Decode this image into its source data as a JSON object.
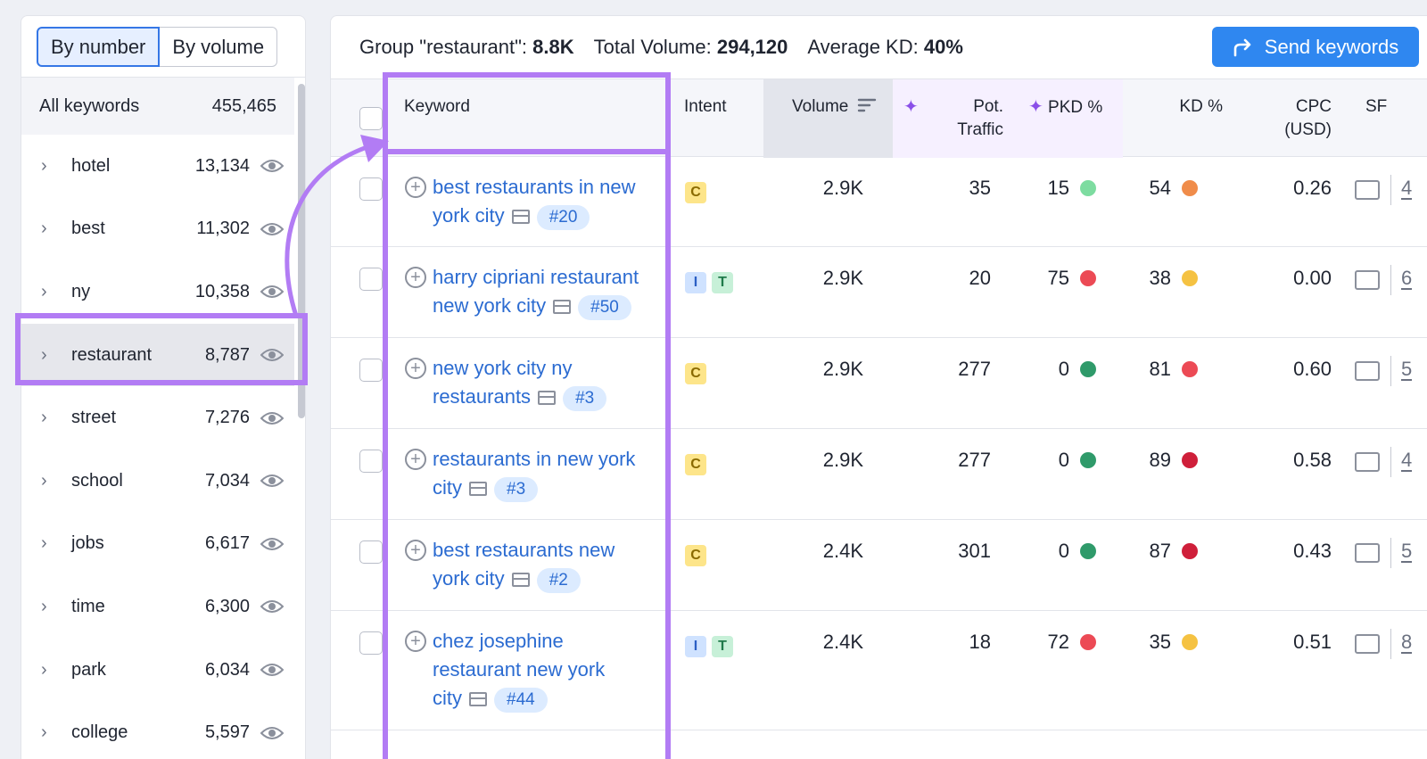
{
  "sidebar": {
    "toggle": {
      "by_number": "By number",
      "by_volume": "By volume"
    },
    "all_keywords": {
      "label": "All keywords",
      "count": "455,465"
    },
    "items": [
      {
        "name": "hotel",
        "count": "13,134"
      },
      {
        "name": "best",
        "count": "11,302"
      },
      {
        "name": "ny",
        "count": "10,358"
      },
      {
        "name": "restaurant",
        "count": "8,787"
      },
      {
        "name": "street",
        "count": "7,276"
      },
      {
        "name": "school",
        "count": "7,034"
      },
      {
        "name": "jobs",
        "count": "6,617"
      },
      {
        "name": "time",
        "count": "6,300"
      },
      {
        "name": "park",
        "count": "6,034"
      },
      {
        "name": "college",
        "count": "5,597"
      }
    ],
    "selected": "restaurant"
  },
  "header": {
    "group_label": "Group \"restaurant\":",
    "group_value": "8.8K",
    "volume_label": "Total Volume:",
    "volume_value": "294,120",
    "kd_label": "Average KD:",
    "kd_value": "40%",
    "send_button": "Send keywords"
  },
  "table": {
    "columns": {
      "keyword": "Keyword",
      "intent": "Intent",
      "volume": "Volume",
      "pot_traffic_1": "Pot.",
      "pot_traffic_2": "Traffic",
      "pkd": "PKD %",
      "kd": "KD %",
      "cpc_1": "CPC",
      "cpc_2": "(USD)",
      "sf": "SF"
    },
    "rows": [
      {
        "kw1": "best restaurants in new",
        "kw2": "york city",
        "kw3": "",
        "rank": "#20",
        "intents": [
          "C"
        ],
        "volume": "2.9K",
        "pot": "35",
        "pkd": "15",
        "pkd_color": "#7ddca0",
        "kd": "54",
        "kd_color": "#f08c4a",
        "cpc": "0.26",
        "sf": "4"
      },
      {
        "kw1": "harry cipriani restaurant",
        "kw2": "new york city",
        "kw3": "",
        "rank": "#50",
        "intents": [
          "I",
          "T"
        ],
        "volume": "2.9K",
        "pot": "20",
        "pkd": "75",
        "pkd_color": "#ec4a55",
        "kd": "38",
        "kd_color": "#f5c242",
        "cpc": "0.00",
        "sf": "6"
      },
      {
        "kw1": "new york city ny",
        "kw2": "restaurants",
        "kw3": "",
        "rank": "#3",
        "intents": [
          "C"
        ],
        "volume": "2.9K",
        "pot": "277",
        "pkd": "0",
        "pkd_color": "#2f9a6a",
        "kd": "81",
        "kd_color": "#ec4a55",
        "cpc": "0.60",
        "sf": "5"
      },
      {
        "kw1": "restaurants in new york",
        "kw2": "city",
        "kw3": "",
        "rank": "#3",
        "intents": [
          "C"
        ],
        "volume": "2.9K",
        "pot": "277",
        "pkd": "0",
        "pkd_color": "#2f9a6a",
        "kd": "89",
        "kd_color": "#cf1f3a",
        "cpc": "0.58",
        "sf": "4"
      },
      {
        "kw1": "best restaurants new",
        "kw2": "york city",
        "kw3": "",
        "rank": "#2",
        "intents": [
          "C"
        ],
        "volume": "2.4K",
        "pot": "301",
        "pkd": "0",
        "pkd_color": "#2f9a6a",
        "kd": "87",
        "kd_color": "#cf1f3a",
        "cpc": "0.43",
        "sf": "5"
      },
      {
        "kw1": "chez josephine",
        "kw2": "restaurant new york",
        "kw3": "city",
        "rank": "#44",
        "intents": [
          "I",
          "T"
        ],
        "volume": "2.4K",
        "pot": "18",
        "pkd": "72",
        "pkd_color": "#ec4a55",
        "kd": "35",
        "kd_color": "#f5c242",
        "cpc": "0.51",
        "sf": "8"
      }
    ]
  },
  "colors": {
    "accent": "#2f87f0",
    "highlight": "#b27cf4",
    "link": "#2b6bd1"
  },
  "icons": [
    "chevron-right-icon",
    "eye-icon",
    "share-arrow-icon",
    "sort-icon",
    "sparkle-icon",
    "add-circle-icon",
    "serp-icon",
    "sf-preview-icon"
  ]
}
